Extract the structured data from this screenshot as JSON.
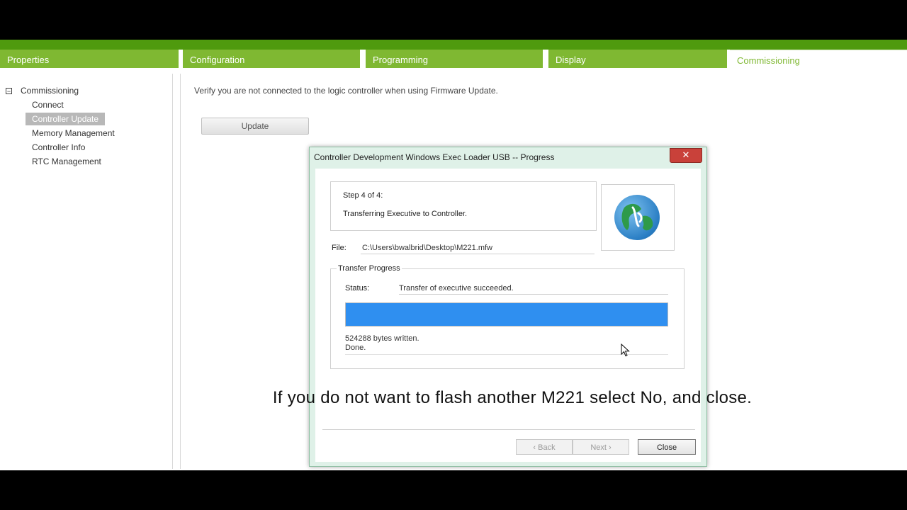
{
  "tabs": [
    {
      "label": "Properties",
      "active": false
    },
    {
      "label": "Configuration",
      "active": false
    },
    {
      "label": "Programming",
      "active": false
    },
    {
      "label": "Display",
      "active": false
    },
    {
      "label": "Commissioning",
      "active": true
    }
  ],
  "sidebar": {
    "root_label": "Commissioning",
    "root_toggle": "−",
    "items": [
      {
        "label": "Connect",
        "selected": false
      },
      {
        "label": "Controller Update",
        "selected": true
      },
      {
        "label": "Memory Management",
        "selected": false
      },
      {
        "label": "Controller Info",
        "selected": false
      },
      {
        "label": "RTC Management",
        "selected": false
      }
    ]
  },
  "main": {
    "verify_text": "Verify you are not connected to the logic controller when using Firmware Update.",
    "update_button": "Update"
  },
  "dialog": {
    "title": "Controller Development Windows Exec Loader USB -- Progress",
    "close_glyph": "✕",
    "step_text": "Step 4 of 4:",
    "step_desc": "Transferring Executive to Controller.",
    "file_label": "File:",
    "file_value": "C:\\Users\\bwalbrid\\Desktop\\M221.mfw",
    "group_title": "Transfer Progress",
    "status_label": "Status:",
    "status_value": "Transfer of executive succeeded.",
    "progress_percent": 100,
    "log_line1": "524288 bytes written.",
    "log_line2": "Done.",
    "back_button": "‹ Back",
    "next_button": "Next ›",
    "close_button": "Close"
  },
  "caption": "If you do not want to flash another M221 select No, and close.",
  "colors": {
    "accent_green": "#7fb832",
    "progress_blue": "#2f8ff0",
    "close_red": "#c9413a"
  },
  "icons": {
    "globe": "globe-icon",
    "cursor": "mouse-pointer-icon"
  }
}
